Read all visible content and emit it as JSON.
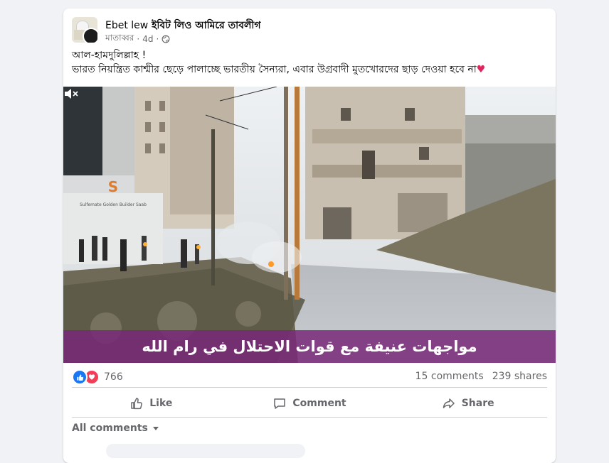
{
  "post": {
    "page_name_latin": "Ebet lew",
    "page_name_bengali": "ইবিট লিও আমিরে তাবলীগ",
    "author_role": "মাতাব্বর",
    "separator": "·",
    "time": "4d",
    "separator2": "·",
    "text_line1": "আল-হামদুলিল্লাহ !",
    "text_line2": "ভারত নিয়ন্ত্রিত কাশ্মীর ছেড়ে পালাচ্ছে ভারতীয় সৈন্যরা, এবার উগ্রবাদী মুতখোরদের ছাড় দেওয়া হবে না",
    "text_emoji": "♥"
  },
  "video": {
    "caption": "مواجهات عنيفة مع قوات الاحتلال في رام الله",
    "brand_sign": "Sulfemate Golden Builder Saab",
    "mute_icon": "volume-muted-icon"
  },
  "stats": {
    "reaction_count": "766",
    "comments": "15 comments",
    "shares": "239 shares"
  },
  "actions": {
    "like": "Like",
    "comment": "Comment",
    "share": "Share"
  },
  "comments_filter": {
    "label": "All comments"
  },
  "colors": {
    "background": "#f0f2f5",
    "card": "#ffffff",
    "like_blue": "#1877f2",
    "love_red": "#f33e58",
    "caption_bar": "#782878",
    "secondary_text": "#65676b"
  }
}
